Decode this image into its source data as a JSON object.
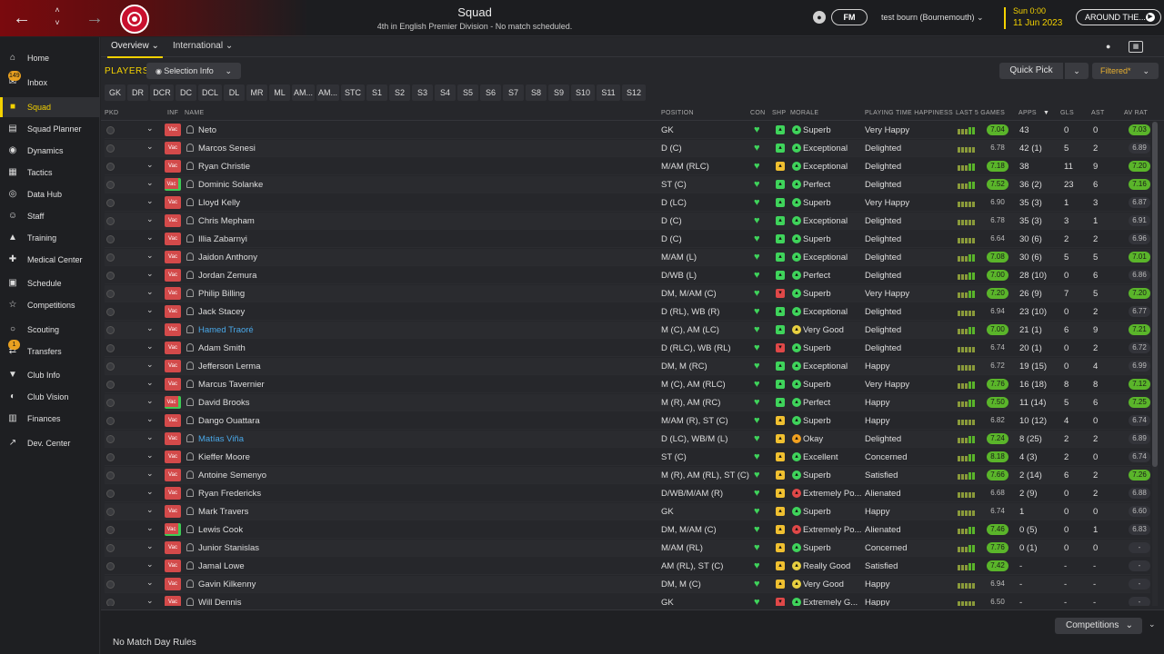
{
  "topbar": {
    "title": "Squad",
    "subtitle": "4th in English Premier Division - No match scheduled.",
    "fm_label": "FM",
    "user": "test bourn (Bournemouth) ⌄",
    "time": "Sun 0:00",
    "date": "11 Jun 2023",
    "continue_label": "AROUND THE...",
    "accent": "#f4d200"
  },
  "sidebar": {
    "items": [
      {
        "label": "Home",
        "icon": "home-icon"
      },
      {
        "label": "Inbox",
        "icon": "inbox-icon",
        "badge": "149"
      },
      {
        "label": "Squad",
        "icon": "shirt-icon",
        "active": true
      },
      {
        "label": "Squad Planner",
        "icon": "clipboard-icon"
      },
      {
        "label": "Dynamics",
        "icon": "dynamics-icon"
      },
      {
        "label": "Tactics",
        "icon": "tactics-icon"
      },
      {
        "label": "Data Hub",
        "icon": "data-hub-icon"
      },
      {
        "label": "Staff",
        "icon": "staff-icon"
      },
      {
        "label": "Training",
        "icon": "training-icon"
      },
      {
        "label": "Medical Center",
        "icon": "medical-icon"
      },
      {
        "label": "Schedule",
        "icon": "calendar-icon"
      },
      {
        "label": "Competitions",
        "icon": "trophy-icon"
      },
      {
        "label": "Scouting",
        "icon": "scouting-icon"
      },
      {
        "label": "Transfers",
        "icon": "transfers-icon",
        "badge": "1"
      },
      {
        "label": "Club Info",
        "icon": "shield-icon"
      },
      {
        "label": "Club Vision",
        "icon": "vision-icon"
      },
      {
        "label": "Finances",
        "icon": "finances-icon"
      },
      {
        "label": "Dev. Center",
        "icon": "dev-center-icon"
      }
    ]
  },
  "subtabs": {
    "overview": "Overview ⌄",
    "international": "International ⌄"
  },
  "toolbar": {
    "players_label": "PLAYERS",
    "selection_info": "Selection Info",
    "quick_pick": "Quick Pick",
    "filtered": "Filtered*"
  },
  "position_filters": [
    "GK",
    "DR",
    "DCR",
    "DC",
    "DCL",
    "DL",
    "MR",
    "ML",
    "AM...",
    "AM...",
    "STC",
    "S1",
    "S2",
    "S3",
    "S4",
    "S5",
    "S6",
    "S7",
    "S8",
    "S9",
    "S10",
    "S11",
    "S12"
  ],
  "columns": {
    "pkd": "PKD",
    "inf": "INF",
    "name": "NAME",
    "position": "POSITION",
    "con": "CON",
    "shp": "SHP",
    "morale": "MORALE",
    "pth": "PLAYING TIME HAPPINESS",
    "last5": "LAST 5 GAMES",
    "apps": "APPS",
    "gls": "GLS",
    "ast": "AST",
    "avrat": "AV RAT"
  },
  "players": [
    {
      "name": "Neto",
      "position": "GK",
      "shp": "up",
      "morale": "Superb",
      "mc": "g",
      "pth": "Very Happy",
      "last5": "7.04",
      "l5hi": true,
      "apps": "43",
      "gls": "0",
      "ast": "0",
      "avrat": "7.03",
      "avhi": true,
      "inj": false
    },
    {
      "name": "Marcos Senesi",
      "position": "D (C)",
      "shp": "up",
      "morale": "Exceptional",
      "mc": "g",
      "pth": "Delighted",
      "last5": "6.78",
      "l5hi": false,
      "apps": "42 (1)",
      "gls": "5",
      "ast": "2",
      "avrat": "6.89",
      "avhi": false,
      "inj": false
    },
    {
      "name": "Ryan Christie",
      "position": "M/AM (RLC)",
      "shp": "yel",
      "morale": "Exceptional",
      "mc": "g",
      "pth": "Delighted",
      "last5": "7.18",
      "l5hi": true,
      "apps": "38",
      "gls": "11",
      "ast": "9",
      "avrat": "7.20",
      "avhi": true,
      "inj": false
    },
    {
      "name": "Dominic Solanke",
      "position": "ST (C)",
      "shp": "up",
      "morale": "Perfect",
      "mc": "g",
      "pth": "Delighted",
      "last5": "7.52",
      "l5hi": true,
      "apps": "36 (2)",
      "gls": "23",
      "ast": "6",
      "avrat": "7.16",
      "avhi": true,
      "inj": true
    },
    {
      "name": "Lloyd Kelly",
      "position": "D (LC)",
      "shp": "up",
      "morale": "Superb",
      "mc": "g",
      "pth": "Very Happy",
      "last5": "6.90",
      "l5hi": false,
      "apps": "35 (3)",
      "gls": "1",
      "ast": "3",
      "avrat": "6.87",
      "avhi": false,
      "inj": false
    },
    {
      "name": "Chris Mepham",
      "position": "D (C)",
      "shp": "up",
      "morale": "Exceptional",
      "mc": "g",
      "pth": "Delighted",
      "last5": "6.78",
      "l5hi": false,
      "apps": "35 (3)",
      "gls": "3",
      "ast": "1",
      "avrat": "6.91",
      "avhi": false,
      "inj": false
    },
    {
      "name": "Illia Zabarnyi",
      "position": "D (C)",
      "shp": "up",
      "morale": "Superb",
      "mc": "g",
      "pth": "Delighted",
      "last5": "6.64",
      "l5hi": false,
      "apps": "30 (6)",
      "gls": "2",
      "ast": "2",
      "avrat": "6.96",
      "avhi": false,
      "inj": false
    },
    {
      "name": "Jaidon Anthony",
      "position": "M/AM (L)",
      "shp": "up",
      "morale": "Exceptional",
      "mc": "g",
      "pth": "Delighted",
      "last5": "7.08",
      "l5hi": true,
      "apps": "30 (6)",
      "gls": "5",
      "ast": "5",
      "avrat": "7.01",
      "avhi": true,
      "inj": false
    },
    {
      "name": "Jordan Zemura",
      "position": "D/WB (L)",
      "shp": "up",
      "morale": "Perfect",
      "mc": "g",
      "pth": "Delighted",
      "last5": "7.00",
      "l5hi": true,
      "apps": "28 (10)",
      "gls": "0",
      "ast": "6",
      "avrat": "6.86",
      "avhi": false,
      "inj": false
    },
    {
      "name": "Philip Billing",
      "position": "DM, M/AM (C)",
      "shp": "red",
      "morale": "Superb",
      "mc": "g",
      "pth": "Very Happy",
      "last5": "7.20",
      "l5hi": true,
      "apps": "26 (9)",
      "gls": "7",
      "ast": "5",
      "avrat": "7.20",
      "avhi": true,
      "inj": false
    },
    {
      "name": "Jack Stacey",
      "position": "D (RL), WB (R)",
      "shp": "up",
      "morale": "Exceptional",
      "mc": "g",
      "pth": "Delighted",
      "last5": "6.94",
      "l5hi": false,
      "apps": "23 (10)",
      "gls": "0",
      "ast": "2",
      "avrat": "6.77",
      "avhi": false,
      "inj": false
    },
    {
      "name": "Hamed Traoré",
      "position": "M (C), AM (LC)",
      "shp": "up",
      "morale": "Very Good",
      "mc": "y",
      "pth": "Delighted",
      "last5": "7.00",
      "l5hi": true,
      "apps": "21 (1)",
      "gls": "6",
      "ast": "9",
      "avrat": "7.21",
      "avhi": true,
      "inj": false,
      "link": true
    },
    {
      "name": "Adam Smith",
      "position": "D (RLC), WB (RL)",
      "shp": "red",
      "morale": "Superb",
      "mc": "g",
      "pth": "Delighted",
      "last5": "6.74",
      "l5hi": false,
      "apps": "20 (1)",
      "gls": "0",
      "ast": "2",
      "avrat": "6.72",
      "avhi": false,
      "inj": false
    },
    {
      "name": "Jefferson Lerma",
      "position": "DM, M (RC)",
      "shp": "up",
      "morale": "Exceptional",
      "mc": "g",
      "pth": "Happy",
      "last5": "6.72",
      "l5hi": false,
      "apps": "19 (15)",
      "gls": "0",
      "ast": "4",
      "avrat": "6.99",
      "avhi": false,
      "inj": false
    },
    {
      "name": "Marcus Tavernier",
      "position": "M (C), AM (RLC)",
      "shp": "up",
      "morale": "Superb",
      "mc": "g",
      "pth": "Very Happy",
      "last5": "7.76",
      "l5hi": true,
      "apps": "16 (18)",
      "gls": "8",
      "ast": "8",
      "avrat": "7.12",
      "avhi": true,
      "inj": false
    },
    {
      "name": "David Brooks",
      "position": "M (R), AM (RC)",
      "shp": "up",
      "morale": "Perfect",
      "mc": "g",
      "pth": "Happy",
      "last5": "7.50",
      "l5hi": true,
      "apps": "11 (14)",
      "gls": "5",
      "ast": "6",
      "avrat": "7.25",
      "avhi": true,
      "inj": true
    },
    {
      "name": "Dango Ouattara",
      "position": "M/AM (R), ST (C)",
      "shp": "yel",
      "morale": "Superb",
      "mc": "g",
      "pth": "Happy",
      "last5": "6.82",
      "l5hi": false,
      "apps": "10 (12)",
      "gls": "4",
      "ast": "0",
      "avrat": "6.74",
      "avhi": false,
      "inj": false
    },
    {
      "name": "Matías Viña",
      "position": "D (LC), WB/M (L)",
      "shp": "yel",
      "morale": "Okay",
      "mc": "o",
      "pth": "Delighted",
      "last5": "7.24",
      "l5hi": true,
      "apps": "8 (25)",
      "gls": "2",
      "ast": "2",
      "avrat": "6.89",
      "avhi": false,
      "inj": false,
      "link": true
    },
    {
      "name": "Kieffer Moore",
      "position": "ST (C)",
      "shp": "yel",
      "morale": "Excellent",
      "mc": "g",
      "pth": "Concerned",
      "last5": "8.18",
      "l5hi": true,
      "apps": "4 (3)",
      "gls": "2",
      "ast": "0",
      "avrat": "6.74",
      "avhi": false,
      "inj": false
    },
    {
      "name": "Antoine Semenyo",
      "position": "M (R), AM (RL), ST (C)",
      "shp": "yel",
      "morale": "Superb",
      "mc": "g",
      "pth": "Satisfied",
      "last5": "7.66",
      "l5hi": true,
      "apps": "2 (14)",
      "gls": "6",
      "ast": "2",
      "avrat": "7.26",
      "avhi": true,
      "inj": false
    },
    {
      "name": "Ryan Fredericks",
      "position": "D/WB/M/AM (R)",
      "shp": "yel",
      "morale": "Extremely Po...",
      "mc": "r",
      "pth": "Alienated",
      "last5": "6.68",
      "l5hi": false,
      "apps": "2 (9)",
      "gls": "0",
      "ast": "2",
      "avrat": "6.88",
      "avhi": false,
      "inj": false
    },
    {
      "name": "Mark Travers",
      "position": "GK",
      "shp": "yel",
      "morale": "Superb",
      "mc": "g",
      "pth": "Happy",
      "last5": "6.74",
      "l5hi": false,
      "apps": "1",
      "gls": "0",
      "ast": "0",
      "avrat": "6.60",
      "avhi": false,
      "inj": false
    },
    {
      "name": "Lewis Cook",
      "position": "DM, M/AM (C)",
      "shp": "yel",
      "morale": "Extremely Po...",
      "mc": "r",
      "pth": "Alienated",
      "last5": "7.46",
      "l5hi": true,
      "apps": "0 (5)",
      "gls": "0",
      "ast": "1",
      "avrat": "6.83",
      "avhi": false,
      "inj": true
    },
    {
      "name": "Junior Stanislas",
      "position": "M/AM (RL)",
      "shp": "yel",
      "morale": "Superb",
      "mc": "g",
      "pth": "Concerned",
      "last5": "7.76",
      "l5hi": true,
      "apps": "0 (1)",
      "gls": "0",
      "ast": "0",
      "avrat": "-",
      "avhi": false,
      "inj": false
    },
    {
      "name": "Jamal Lowe",
      "position": "AM (RL), ST (C)",
      "shp": "yel",
      "morale": "Really Good",
      "mc": "y",
      "pth": "Satisfied",
      "last5": "7.42",
      "l5hi": true,
      "apps": "-",
      "gls": "-",
      "ast": "-",
      "avrat": "-",
      "avhi": false,
      "inj": false
    },
    {
      "name": "Gavin Kilkenny",
      "position": "DM, M (C)",
      "shp": "yel",
      "morale": "Very Good",
      "mc": "y",
      "pth": "Happy",
      "last5": "6.94",
      "l5hi": false,
      "apps": "-",
      "gls": "-",
      "ast": "-",
      "avrat": "-",
      "avhi": false,
      "inj": false
    },
    {
      "name": "Will Dennis",
      "position": "GK",
      "shp": "red",
      "morale": "Extremely G...",
      "mc": "g",
      "pth": "Happy",
      "last5": "6.50",
      "l5hi": false,
      "apps": "-",
      "gls": "-",
      "ast": "-",
      "avrat": "-",
      "avhi": false,
      "inj": false
    }
  ],
  "row_labels": {
    "vac": "Vac"
  },
  "footer": {
    "rules": "No Match Day Rules",
    "competitions": "Competitions"
  }
}
